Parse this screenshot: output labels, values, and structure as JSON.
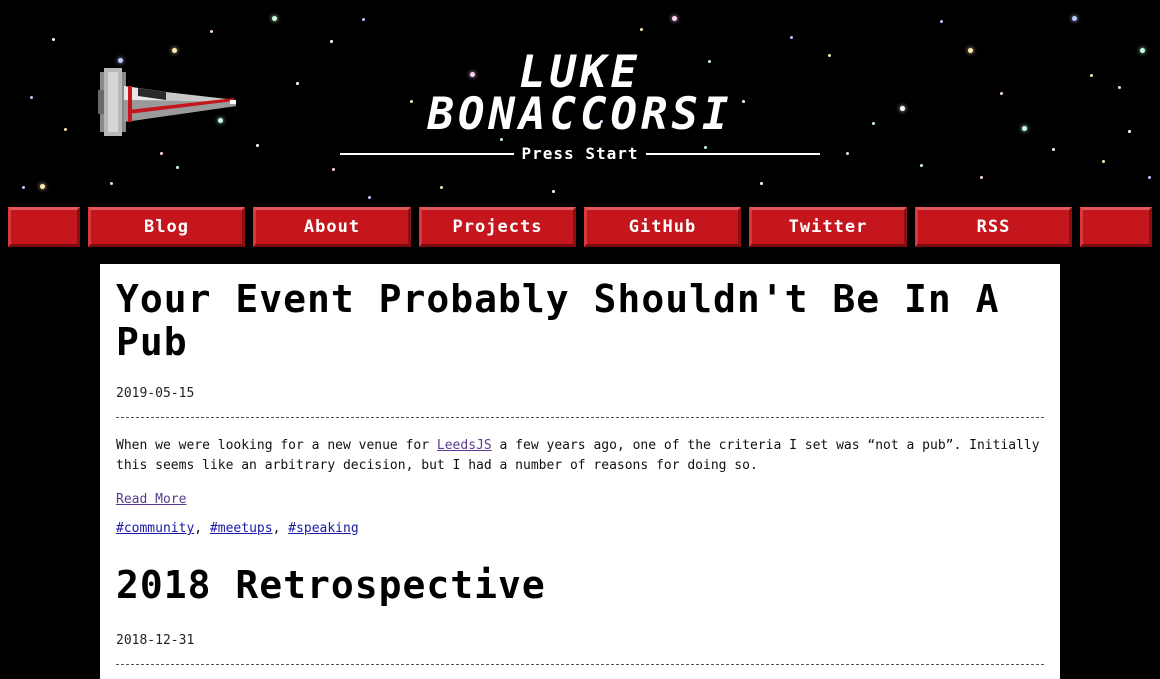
{
  "site": {
    "title_line1": "LUKE",
    "title_line2": "BONACCORSI",
    "tagline": "Press Start"
  },
  "nav": {
    "items": [
      {
        "label": ""
      },
      {
        "label": "Blog"
      },
      {
        "label": "About"
      },
      {
        "label": "Projects"
      },
      {
        "label": "GitHub"
      },
      {
        "label": "Twitter"
      },
      {
        "label": "RSS"
      },
      {
        "label": ""
      }
    ]
  },
  "posts": [
    {
      "title": "Your Event Probably Shouldn't Be In A Pub",
      "date": "2019-05-15",
      "body_before_link": "When we were looking for a new venue for ",
      "body_link": "LeedsJS",
      "body_after_link": " a few years ago, one of the criteria I set was “not a pub”. Initially this seems like an arbitrary decision, but I had a number of reasons for doing so.",
      "read_more": "Read More",
      "tags": [
        "#community",
        "#meetups",
        "#speaking"
      ],
      "tag_separator": ", "
    },
    {
      "title": "2018 Retrospective",
      "date": "2018-12-31"
    }
  ],
  "colors": {
    "background": "#000000",
    "nav_button": "#c4161c",
    "content_bg": "#ffffff",
    "link": "#5a3a8c",
    "tag_link": "#1a1aa6"
  },
  "icons": {
    "ship": "spaceship-icon",
    "stars": "star-icon"
  }
}
